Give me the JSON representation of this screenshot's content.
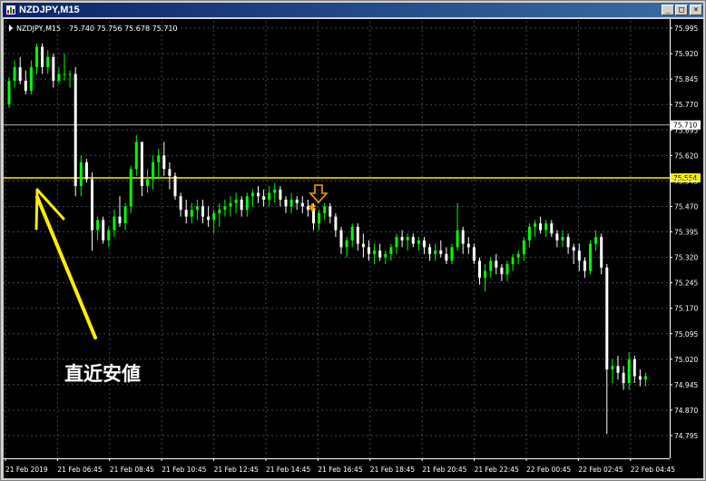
{
  "window": {
    "title": "NZDJPY,M15"
  },
  "header": {
    "symbol": "NZDJPY,M15",
    "ohlc": "75.740 75.756 75.678 75.710"
  },
  "annotation": {
    "text": "直近安値"
  },
  "colors": {
    "background": "#000000",
    "grid": "#384b5b",
    "bull": "#00ff00",
    "bear": "#ffffff",
    "level": "#ffee00",
    "arrow": "#ffd700",
    "signal": "#ff9900",
    "current": "#b0b0b0",
    "axis_text": "#ffffff"
  },
  "icons": {
    "window": "chart-window-icon",
    "minimize": "minimize-icon",
    "maximize": "maximize-icon",
    "close": "close-icon",
    "signal_arrow": "down-arrow-icon",
    "signal_star": "star-icon"
  },
  "chart_data": {
    "type": "candlestick",
    "ylim": [
      74.74,
      76.0
    ],
    "y_ticks": [
      "75.995",
      "75.920",
      "75.845",
      "75.770",
      "75.695",
      "75.620",
      "75.545",
      "75.470",
      "75.395",
      "75.320",
      "75.245",
      "75.170",
      "75.095",
      "75.020",
      "74.945",
      "74.870",
      "74.795"
    ],
    "x_ticks": [
      "21 Feb 2019",
      "21 Feb 06:45",
      "21 Feb 08:45",
      "21 Feb 10:45",
      "21 Feb 12:45",
      "21 Feb 14:45",
      "21 Feb 16:45",
      "21 Feb 18:45",
      "21 Feb 20:45",
      "21 Feb 22:45",
      "22 Feb 00:45",
      "22 Feb 02:45",
      "22 Feb 04:45"
    ],
    "levels": [
      {
        "label": "75.710",
        "value": 75.71,
        "kind": "current"
      },
      {
        "label": "75.554",
        "value": 75.554,
        "kind": "support"
      }
    ],
    "candles": [
      [
        75.77,
        75.85,
        75.76,
        75.84
      ],
      [
        75.84,
        75.9,
        75.82,
        75.88
      ],
      [
        75.88,
        75.91,
        75.83,
        75.84
      ],
      [
        75.84,
        75.87,
        75.8,
        75.81
      ],
      [
        75.81,
        75.9,
        75.8,
        75.88
      ],
      [
        75.88,
        75.95,
        75.86,
        75.94
      ],
      [
        75.94,
        75.95,
        75.86,
        75.88
      ],
      [
        75.88,
        75.93,
        75.86,
        75.91
      ],
      [
        75.91,
        75.92,
        75.82,
        75.84
      ],
      [
        75.84,
        75.88,
        75.83,
        75.86
      ],
      [
        75.86,
        75.92,
        75.84,
        75.86
      ],
      [
        75.86,
        75.87,
        75.82,
        75.86
      ],
      [
        75.86,
        75.88,
        75.5,
        75.53
      ],
      [
        75.53,
        75.62,
        75.5,
        75.6
      ],
      [
        75.6,
        75.61,
        75.54,
        75.55
      ],
      [
        75.55,
        75.57,
        75.34,
        75.4
      ],
      [
        75.4,
        75.44,
        75.37,
        75.43
      ],
      [
        75.43,
        75.44,
        75.36,
        75.37
      ],
      [
        75.37,
        75.41,
        75.35,
        75.4
      ],
      [
        75.4,
        75.46,
        75.38,
        75.44
      ],
      [
        75.44,
        75.5,
        75.41,
        75.42
      ],
      [
        75.42,
        75.48,
        75.4,
        75.47
      ],
      [
        75.47,
        75.59,
        75.45,
        75.58
      ],
      [
        75.58,
        75.68,
        75.56,
        75.66
      ],
      [
        75.66,
        75.66,
        75.5,
        75.53
      ],
      [
        75.53,
        75.58,
        75.51,
        75.55
      ],
      [
        75.55,
        75.62,
        75.52,
        75.6
      ],
      [
        75.6,
        75.64,
        75.55,
        75.62
      ],
      [
        75.62,
        75.66,
        75.56,
        75.58
      ],
      [
        75.58,
        75.6,
        75.52,
        75.56
      ],
      [
        75.56,
        75.57,
        75.49,
        75.5
      ],
      [
        75.5,
        75.51,
        75.44,
        75.46
      ],
      [
        75.46,
        75.49,
        75.42,
        75.44
      ],
      [
        75.44,
        75.48,
        75.42,
        75.46
      ],
      [
        75.46,
        75.49,
        75.43,
        75.47
      ],
      [
        75.47,
        75.49,
        75.42,
        75.44
      ],
      [
        75.44,
        75.47,
        75.41,
        75.43
      ],
      [
        75.43,
        75.46,
        75.39,
        75.45
      ],
      [
        75.45,
        75.48,
        75.41,
        75.46
      ],
      [
        75.46,
        75.49,
        75.44,
        75.47
      ],
      [
        75.47,
        75.5,
        75.44,
        75.48
      ],
      [
        75.48,
        75.51,
        75.45,
        75.49
      ],
      [
        75.49,
        75.5,
        75.44,
        75.46
      ],
      [
        75.46,
        75.51,
        75.44,
        75.5
      ],
      [
        75.5,
        75.52,
        75.47,
        75.51
      ],
      [
        75.51,
        75.53,
        75.48,
        75.5
      ],
      [
        75.5,
        75.52,
        75.47,
        75.49
      ],
      [
        75.49,
        75.53,
        75.47,
        75.51
      ],
      [
        75.51,
        75.54,
        75.48,
        75.52
      ],
      [
        75.52,
        75.53,
        75.47,
        75.49
      ],
      [
        75.49,
        75.5,
        75.45,
        75.47
      ],
      [
        75.47,
        75.51,
        75.45,
        75.49
      ],
      [
        75.49,
        75.5,
        75.46,
        75.48
      ],
      [
        75.48,
        75.5,
        75.45,
        75.47
      ],
      [
        75.47,
        75.49,
        75.44,
        75.46
      ],
      [
        75.46,
        75.48,
        75.4,
        75.42
      ],
      [
        75.42,
        75.46,
        75.4,
        75.45
      ],
      [
        75.45,
        75.48,
        75.43,
        75.47
      ],
      [
        75.47,
        75.48,
        75.42,
        75.44
      ],
      [
        75.44,
        75.45,
        75.38,
        75.4
      ],
      [
        75.4,
        75.41,
        75.33,
        75.35
      ],
      [
        75.35,
        75.38,
        75.32,
        75.37
      ],
      [
        75.37,
        75.42,
        75.35,
        75.41
      ],
      [
        75.41,
        75.42,
        75.34,
        75.36
      ],
      [
        75.36,
        75.39,
        75.32,
        75.35
      ],
      [
        75.35,
        75.37,
        75.31,
        75.33
      ],
      [
        75.33,
        75.36,
        75.3,
        75.34
      ],
      [
        75.34,
        75.36,
        75.31,
        75.32
      ],
      [
        75.32,
        75.34,
        75.3,
        75.33
      ],
      [
        75.33,
        75.36,
        75.31,
        75.35
      ],
      [
        75.35,
        75.39,
        75.33,
        75.38
      ],
      [
        75.38,
        75.4,
        75.35,
        75.37
      ],
      [
        75.37,
        75.39,
        75.34,
        75.38
      ],
      [
        75.38,
        75.39,
        75.35,
        75.36
      ],
      [
        75.36,
        75.38,
        75.34,
        75.37
      ],
      [
        75.37,
        75.38,
        75.33,
        75.35
      ],
      [
        75.35,
        75.36,
        75.31,
        75.33
      ],
      [
        75.33,
        75.36,
        75.31,
        75.34
      ],
      [
        75.34,
        75.37,
        75.32,
        75.33
      ],
      [
        75.33,
        75.35,
        75.3,
        75.31
      ],
      [
        75.31,
        75.36,
        75.3,
        75.35
      ],
      [
        75.35,
        75.48,
        75.34,
        75.4
      ],
      [
        75.4,
        75.41,
        75.33,
        75.36
      ],
      [
        75.36,
        75.38,
        75.33,
        75.35
      ],
      [
        75.35,
        75.36,
        75.3,
        75.31
      ],
      [
        75.31,
        75.32,
        75.24,
        75.26
      ],
      [
        75.26,
        75.3,
        75.22,
        75.28
      ],
      [
        75.28,
        75.32,
        75.26,
        75.31
      ],
      [
        75.31,
        75.33,
        75.27,
        75.29
      ],
      [
        75.29,
        75.3,
        75.25,
        75.27
      ],
      [
        75.27,
        75.31,
        75.25,
        75.3
      ],
      [
        75.3,
        75.33,
        75.28,
        75.32
      ],
      [
        75.32,
        75.34,
        75.3,
        75.33
      ],
      [
        75.33,
        75.38,
        75.31,
        75.37
      ],
      [
        75.37,
        75.42,
        75.35,
        75.41
      ],
      [
        75.41,
        75.43,
        75.38,
        75.42
      ],
      [
        75.42,
        75.44,
        75.39,
        75.4
      ],
      [
        75.4,
        75.43,
        75.38,
        75.42
      ],
      [
        75.42,
        75.43,
        75.38,
        75.39
      ],
      [
        75.39,
        75.4,
        75.35,
        75.37
      ],
      [
        75.37,
        75.4,
        75.35,
        75.38
      ],
      [
        75.38,
        75.39,
        75.33,
        75.35
      ],
      [
        75.35,
        75.36,
        75.3,
        75.34
      ],
      [
        75.34,
        75.36,
        75.28,
        75.31
      ],
      [
        75.31,
        75.32,
        75.26,
        75.28
      ],
      [
        75.28,
        75.37,
        75.27,
        75.36
      ],
      [
        75.36,
        75.4,
        75.34,
        75.38
      ],
      [
        75.38,
        75.39,
        75.27,
        75.29
      ],
      [
        75.29,
        75.3,
        74.8,
        74.99
      ],
      [
        74.99,
        75.02,
        74.95,
        75.0
      ],
      [
        75.0,
        75.03,
        74.96,
        74.98
      ],
      [
        74.98,
        75.0,
        74.93,
        74.95
      ],
      [
        74.95,
        75.04,
        74.93,
        75.02
      ],
      [
        75.02,
        75.03,
        74.95,
        74.97
      ],
      [
        74.97,
        74.99,
        74.94,
        74.96
      ],
      [
        74.96,
        74.98,
        74.94,
        74.97
      ]
    ]
  }
}
